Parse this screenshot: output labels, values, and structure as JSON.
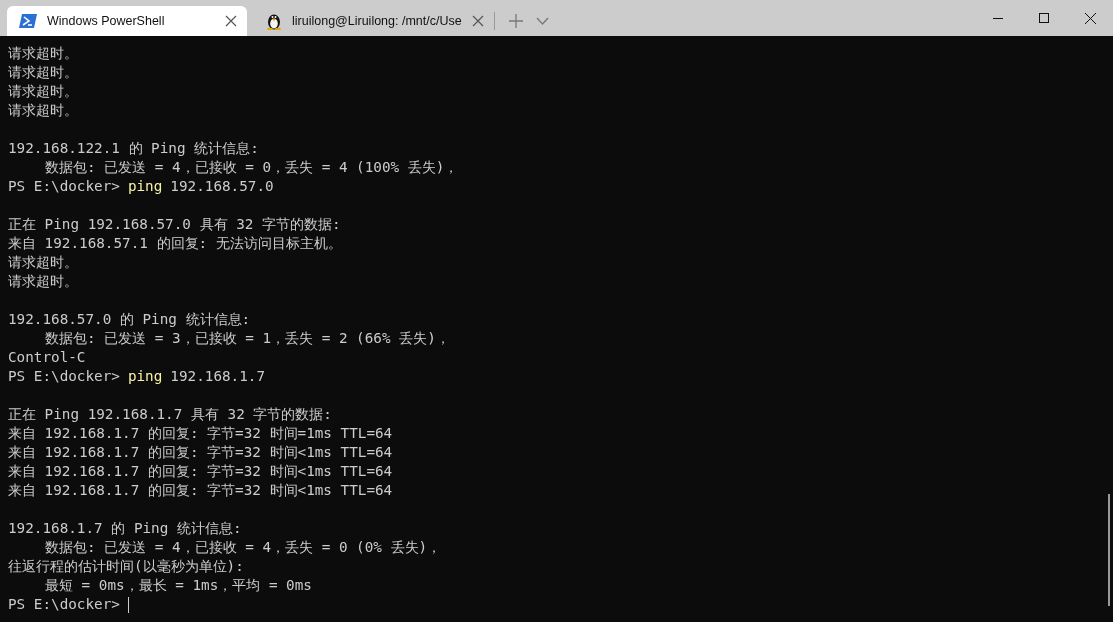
{
  "tabs": [
    {
      "kind": "powershell",
      "title": "Windows PowerShell",
      "selected": true
    },
    {
      "kind": "linux",
      "title": "liruilong@Liruilong: /mnt/c/Use",
      "selected": false
    }
  ],
  "terminal": {
    "lines": [
      {
        "kind": "output",
        "text": "请求超时。",
        "indented": false
      },
      {
        "kind": "output",
        "text": "请求超时。",
        "indented": false
      },
      {
        "kind": "output",
        "text": "请求超时。",
        "indented": false
      },
      {
        "kind": "output",
        "text": "请求超时。",
        "indented": false
      },
      {
        "kind": "blank"
      },
      {
        "kind": "output",
        "text": "192.168.122.1 的 Ping 统计信息:",
        "indented": false
      },
      {
        "kind": "output",
        "text": "数据包: 已发送 = 4，已接收 = 0，丢失 = 4 (100% 丢失)，",
        "indented": true
      },
      {
        "kind": "prompt",
        "prompt": "PS E:\\docker>",
        "command": "ping",
        "args": "192.168.57.0",
        "cursor": false
      },
      {
        "kind": "blank"
      },
      {
        "kind": "output",
        "text": "正在 Ping 192.168.57.0 具有 32 字节的数据:",
        "indented": false
      },
      {
        "kind": "output",
        "text": "来自 192.168.57.1 的回复: 无法访问目标主机。",
        "indented": false
      },
      {
        "kind": "output",
        "text": "请求超时。",
        "indented": false
      },
      {
        "kind": "output",
        "text": "请求超时。",
        "indented": false
      },
      {
        "kind": "blank"
      },
      {
        "kind": "output",
        "text": "192.168.57.0 的 Ping 统计信息:",
        "indented": false
      },
      {
        "kind": "output",
        "text": "数据包: 已发送 = 3，已接收 = 1，丢失 = 2 (66% 丢失)，",
        "indented": true
      },
      {
        "kind": "output",
        "text": "Control-C",
        "indented": false
      },
      {
        "kind": "prompt",
        "prompt": "PS E:\\docker>",
        "command": "ping",
        "args": "192.168.1.7",
        "cursor": false
      },
      {
        "kind": "blank"
      },
      {
        "kind": "output",
        "text": "正在 Ping 192.168.1.7 具有 32 字节的数据:",
        "indented": false
      },
      {
        "kind": "output",
        "text": "来自 192.168.1.7 的回复: 字节=32 时间=1ms TTL=64",
        "indented": false
      },
      {
        "kind": "output",
        "text": "来自 192.168.1.7 的回复: 字节=32 时间<1ms TTL=64",
        "indented": false
      },
      {
        "kind": "output",
        "text": "来自 192.168.1.7 的回复: 字节=32 时间<1ms TTL=64",
        "indented": false
      },
      {
        "kind": "output",
        "text": "来自 192.168.1.7 的回复: 字节=32 时间<1ms TTL=64",
        "indented": false
      },
      {
        "kind": "blank"
      },
      {
        "kind": "output",
        "text": "192.168.1.7 的 Ping 统计信息:",
        "indented": false
      },
      {
        "kind": "output",
        "text": "数据包: 已发送 = 4，已接收 = 4，丢失 = 0 (0% 丢失)，",
        "indented": true
      },
      {
        "kind": "output",
        "text": "往返行程的估计时间(以毫秒为单位):",
        "indented": false
      },
      {
        "kind": "output",
        "text": "最短 = 0ms，最长 = 1ms，平均 = 0ms",
        "indented": true
      },
      {
        "kind": "prompt",
        "prompt": "PS E:\\docker>",
        "cursor": true
      }
    ]
  }
}
